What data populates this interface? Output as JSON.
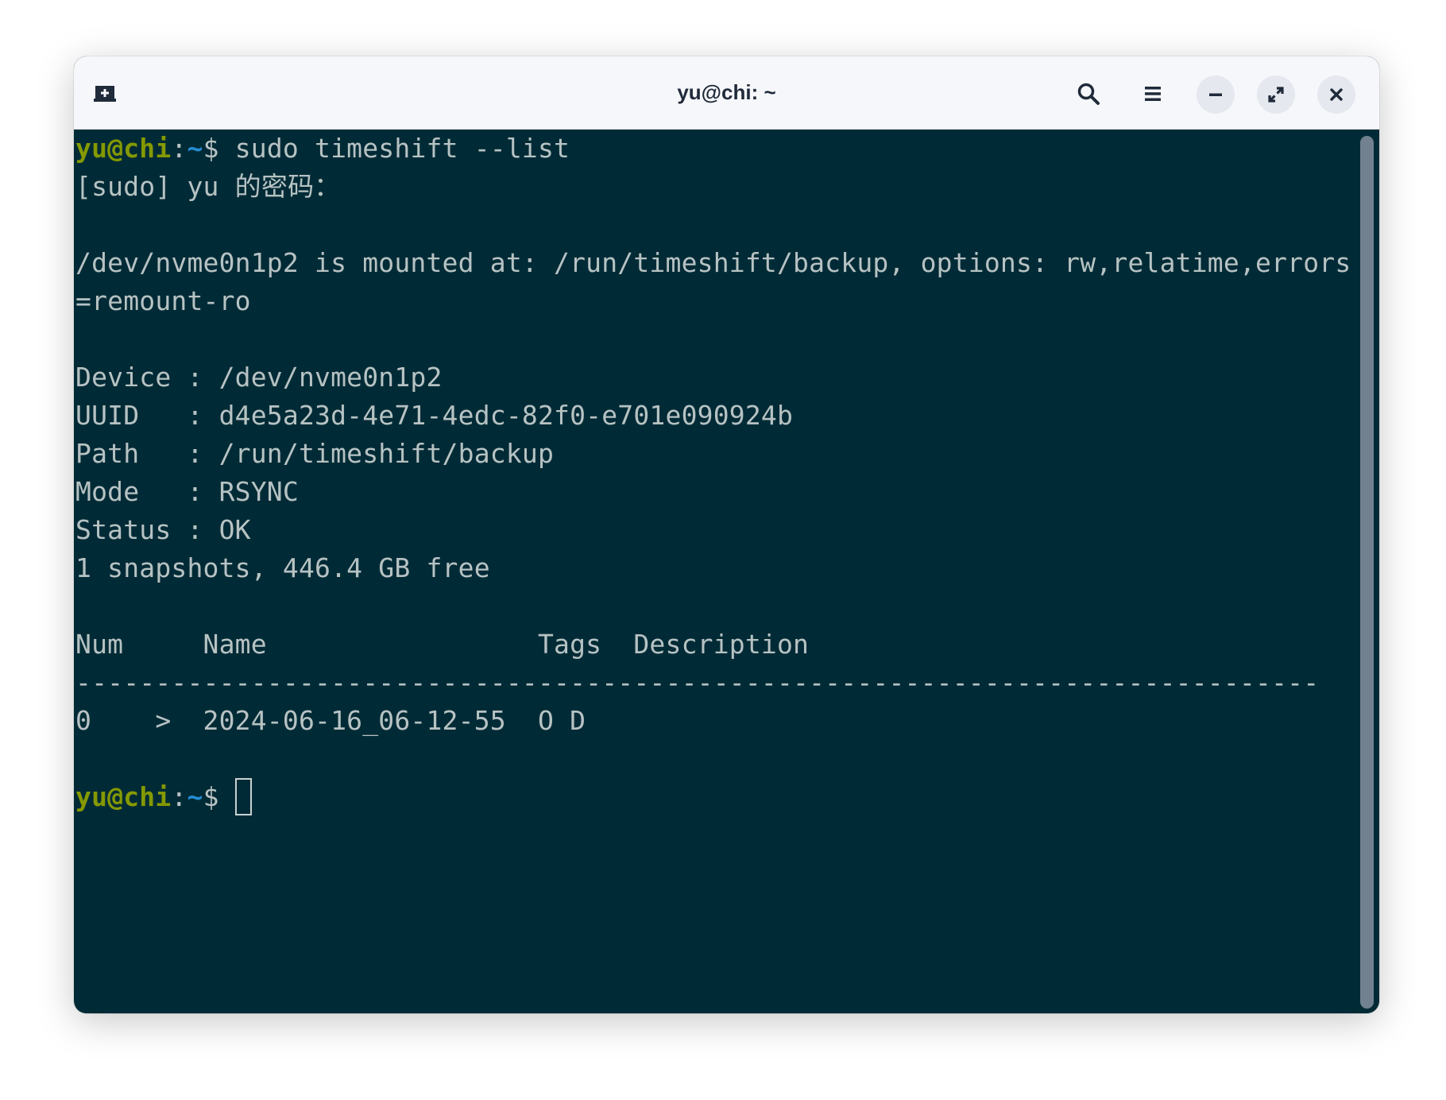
{
  "window": {
    "title": "yu@chi: ~",
    "buttons": {
      "new_tab": "new-tab-icon",
      "search": "search-icon",
      "menu": "hamburger-menu-icon",
      "minimize": "minimize-icon",
      "maximize": "maximize-icon",
      "close": "close-icon"
    }
  },
  "colors": {
    "background": "#002b36",
    "text": "#b7c2c3",
    "prompt_user": "#859900",
    "prompt_path": "#268bd2",
    "titlebar": "#f6f7fa"
  },
  "terminal": {
    "prompt": {
      "user_host": "yu@chi",
      "colon": ":",
      "path": "~",
      "symbol": "$ "
    },
    "command": "sudo timeshift --list",
    "sudo_prompt": "[sudo] yu 的密码：",
    "mount_line_1": "/dev/nvme0n1p2 is mounted at: /run/timeshift/backup, options: rw,relatime,errors",
    "mount_line_2": "=remount-ro",
    "device_line": "Device : /dev/nvme0n1p2",
    "uuid_line": "UUID   : d4e5a23d-4e71-4edc-82f0-e701e090924b",
    "path_line": "Path   : /run/timeshift/backup",
    "mode_line": "Mode   : RSYNC",
    "status_line": "Status : OK",
    "summary_line": "1 snapshots, 446.4 GB free",
    "table_header": "Num     Name                 Tags  Description",
    "table_separator": "------------------------------------------------------------------------------",
    "table_row": "0    >  2024-06-16_06-12-55  O D"
  }
}
